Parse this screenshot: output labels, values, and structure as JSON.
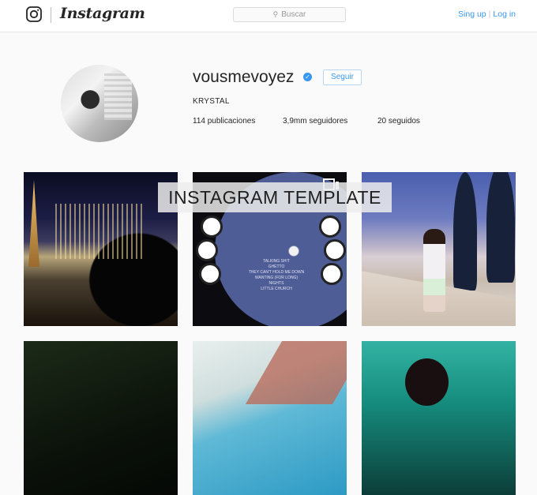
{
  "header": {
    "brand": "Instagram",
    "search_placeholder": "Buscar",
    "signup_label": "Sing up",
    "login_label": "Log in",
    "separator": "|"
  },
  "profile": {
    "username": "vousmevoyez",
    "verified": true,
    "follow_label": "Seguir",
    "full_name": "KRYSTAL",
    "posts_count": "114",
    "posts_label": "publicaciones",
    "followers_count": "3,9mm",
    "followers_label": "seguidores",
    "following_count": "20",
    "following_label": "seguidos"
  },
  "banner": {
    "text": "INSTAGRAM TEMPLATE"
  },
  "record_label": {
    "tracks": [
      "TALKING SH!T",
      "GHETTO",
      "THEY CAN'T HOLD ME DOWN",
      "WANTING (FOR LONG)",
      "NIGHTS",
      "LITTLE CHURCH"
    ]
  },
  "colors": {
    "accent": "#3897f0",
    "background": "#fafafa"
  }
}
